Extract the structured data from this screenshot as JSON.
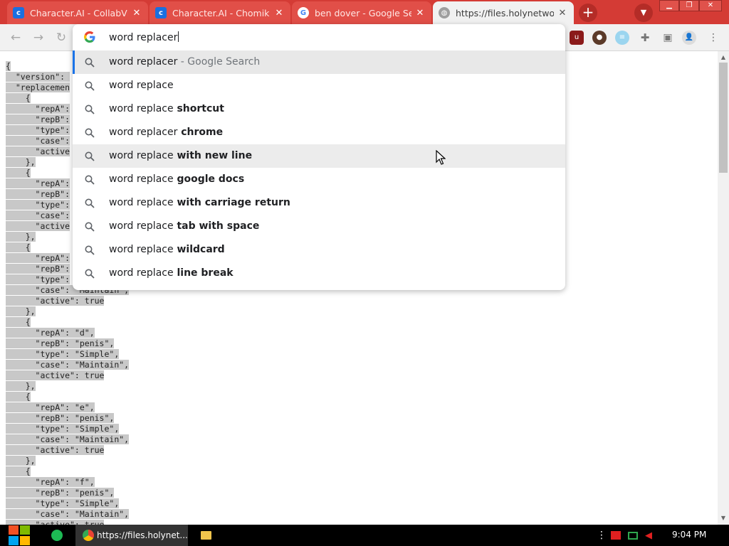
{
  "tabs": [
    {
      "title": "Character.AI - CollabVM",
      "icon": "character-ai-icon",
      "active": false
    },
    {
      "title": "Character.AI - Chomik",
      "icon": "character-ai-icon",
      "active": false
    },
    {
      "title": "ben dover - Google Search",
      "icon": "google-icon",
      "active": false
    },
    {
      "title": "https://files.holynetwork",
      "icon": "globe-icon",
      "active": true
    }
  ],
  "omnibox": {
    "input_value": "word replacer",
    "suggestions": [
      {
        "typed": "word replacer",
        "rest": "",
        "suffix": " - Google Search"
      },
      {
        "typed": "word replace",
        "rest": "",
        "suffix": ""
      },
      {
        "typed": "word replace",
        "rest": " shortcut",
        "suffix": ""
      },
      {
        "typed": "word replacer",
        "rest": " chrome",
        "suffix": ""
      },
      {
        "typed": "word replace",
        "rest": " with new line",
        "suffix": ""
      },
      {
        "typed": "word replace",
        "rest": " google docs",
        "suffix": ""
      },
      {
        "typed": "word replace",
        "rest": " with carriage return",
        "suffix": ""
      },
      {
        "typed": "word replace",
        "rest": " tab with space",
        "suffix": ""
      },
      {
        "typed": "word replace",
        "rest": " wildcard",
        "suffix": ""
      },
      {
        "typed": "word replace",
        "rest": " line break",
        "suffix": ""
      }
    ]
  },
  "json_lines": [
    "{",
    "  \"version\": ",
    "  \"replacemen",
    "    {",
    "      \"repA\":",
    "      \"repB\":",
    "      \"type\":",
    "      \"case\":",
    "      \"active",
    "    },",
    "    {",
    "      \"repA\":",
    "      \"repB\":",
    "      \"type\":",
    "      \"case\":",
    "      \"active",
    "    },",
    "    {",
    "      \"repA\":",
    "      \"repB\":",
    "      \"type\":",
    "      \"case\": \"Maintain\",",
    "      \"active\": true",
    "    },",
    "    {",
    "      \"repA\": \"d\",",
    "      \"repB\": \"penis\",",
    "      \"type\": \"Simple\",",
    "      \"case\": \"Maintain\",",
    "      \"active\": true",
    "    },",
    "    {",
    "      \"repA\": \"e\",",
    "      \"repB\": \"penis\",",
    "      \"type\": \"Simple\",",
    "      \"case\": \"Maintain\",",
    "      \"active\": true",
    "    },",
    "    {",
    "      \"repA\": \"f\",",
    "      \"repB\": \"penis\",",
    "      \"type\": \"Simple\",",
    "      \"case\": \"Maintain\",",
    "      \"active\": true"
  ],
  "taskbar": {
    "chrome_item": "https://files.holynet...",
    "clock": "9:04 PM"
  },
  "colors": {
    "tabstrip": "#d43b35",
    "selection": "#c8c8c8",
    "accent": "#1a73e8"
  }
}
